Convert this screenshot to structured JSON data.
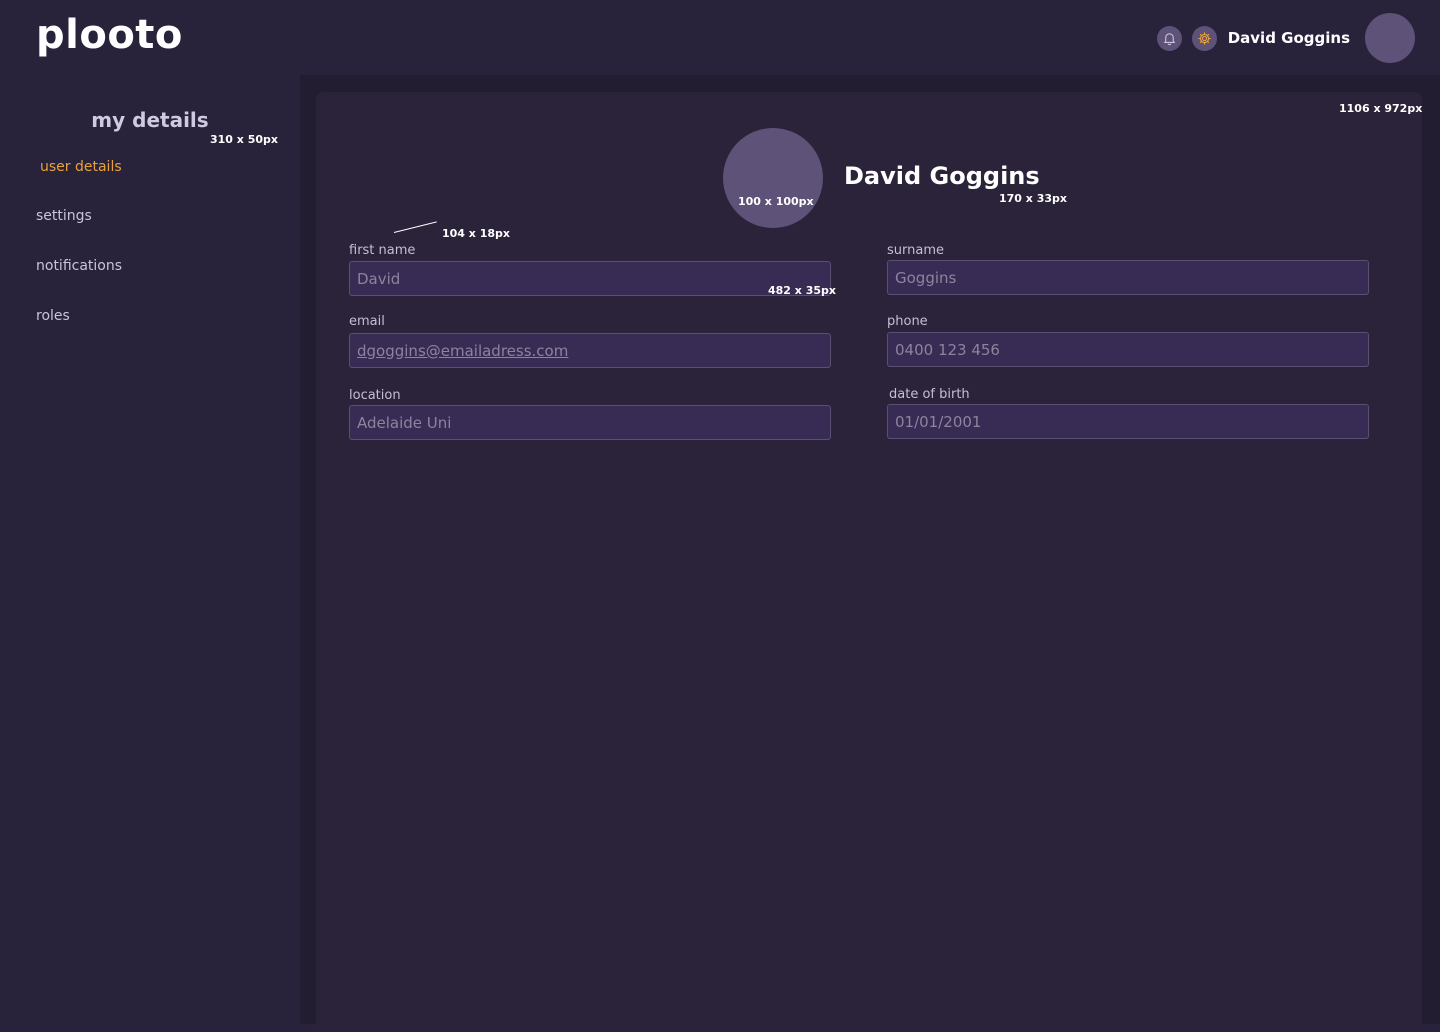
{
  "header": {
    "logo": "plooto",
    "user_name": "David Goggins",
    "icons": [
      "bell-icon",
      "gear-icon"
    ]
  },
  "sidebar": {
    "title": "my details",
    "title_dim_label": "310 x 50px",
    "items": [
      {
        "label": "user details",
        "active": true
      },
      {
        "label": "settings",
        "active": false
      },
      {
        "label": "notifications",
        "active": false
      },
      {
        "label": "roles",
        "active": false
      }
    ]
  },
  "card": {
    "dim_label": "1106 x 972px",
    "avatar_dim_label": "100 x 100px",
    "name": "David Goggins",
    "name_dim_label": "170 x 33px",
    "label_dim_label": "104 x 18px",
    "field_dim_label": "482 x 35px"
  },
  "form": {
    "first_name": {
      "label": "first name",
      "value": "David"
    },
    "surname": {
      "label": "surname",
      "value": "Goggins"
    },
    "email": {
      "label": "email",
      "value": "dgoggins@emailadress.com"
    },
    "phone": {
      "label": "phone",
      "value": "0400 123 456"
    },
    "location": {
      "label": "location",
      "value": "Adelaide Uni"
    },
    "date_of_birth": {
      "label": "date of birth",
      "value": "01/01/2001"
    }
  },
  "colors": {
    "background": "#28223a",
    "card": "#2a2339",
    "accent": "#e8a33c",
    "avatar": "#5e5278",
    "input_bg": "#382c54"
  }
}
